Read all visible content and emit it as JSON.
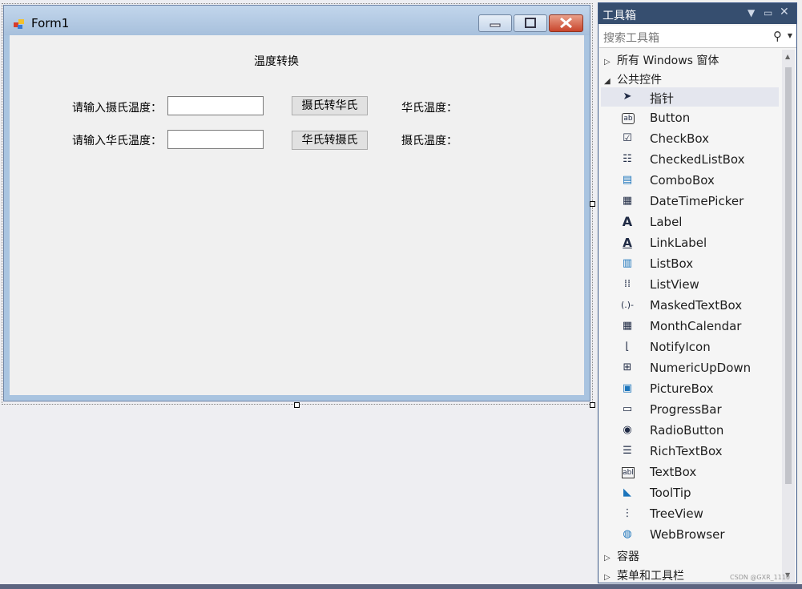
{
  "form": {
    "title": "Form1",
    "heading": "温度转换",
    "celsius_prompt": "请输入摄氏温度：",
    "fahrenheit_prompt": "请输入华氏温度：",
    "btn_c2f": "摄氏转华氏",
    "btn_f2c": "华氏转摄氏",
    "fahrenheit_result_label": "华氏温度：",
    "celsius_result_label": "摄氏温度：",
    "celsius_input_value": "",
    "fahrenheit_input_value": ""
  },
  "toolbox": {
    "title": "工具箱",
    "search_placeholder": "搜索工具箱",
    "categories": {
      "all_windows": "所有 Windows 窗体",
      "common": "公共控件",
      "containers": "容器",
      "menus": "菜单和工具栏"
    },
    "items": [
      {
        "label": "指针",
        "icon": "pointer-icon"
      },
      {
        "label": "Button",
        "icon": "button-icon"
      },
      {
        "label": "CheckBox",
        "icon": "checkbox-icon"
      },
      {
        "label": "CheckedListBox",
        "icon": "checkedlistbox-icon"
      },
      {
        "label": "ComboBox",
        "icon": "combobox-icon"
      },
      {
        "label": "DateTimePicker",
        "icon": "datetimepicker-icon"
      },
      {
        "label": "Label",
        "icon": "label-icon"
      },
      {
        "label": "LinkLabel",
        "icon": "linklabel-icon"
      },
      {
        "label": "ListBox",
        "icon": "listbox-icon"
      },
      {
        "label": "ListView",
        "icon": "listview-icon"
      },
      {
        "label": "MaskedTextBox",
        "icon": "maskedtextbox-icon"
      },
      {
        "label": "MonthCalendar",
        "icon": "monthcalendar-icon"
      },
      {
        "label": "NotifyIcon",
        "icon": "notifyicon-icon"
      },
      {
        "label": "NumericUpDown",
        "icon": "numericupdown-icon"
      },
      {
        "label": "PictureBox",
        "icon": "picturebox-icon"
      },
      {
        "label": "ProgressBar",
        "icon": "progressbar-icon"
      },
      {
        "label": "RadioButton",
        "icon": "radiobutton-icon"
      },
      {
        "label": "RichTextBox",
        "icon": "richtextbox-icon"
      },
      {
        "label": "TextBox",
        "icon": "textbox-icon"
      },
      {
        "label": "ToolTip",
        "icon": "tooltip-icon"
      },
      {
        "label": "TreeView",
        "icon": "treeview-icon"
      },
      {
        "label": "WebBrowser",
        "icon": "webbrowser-icon"
      }
    ],
    "selected_item": "指针"
  },
  "watermark": "CSDN @GXR_1110"
}
